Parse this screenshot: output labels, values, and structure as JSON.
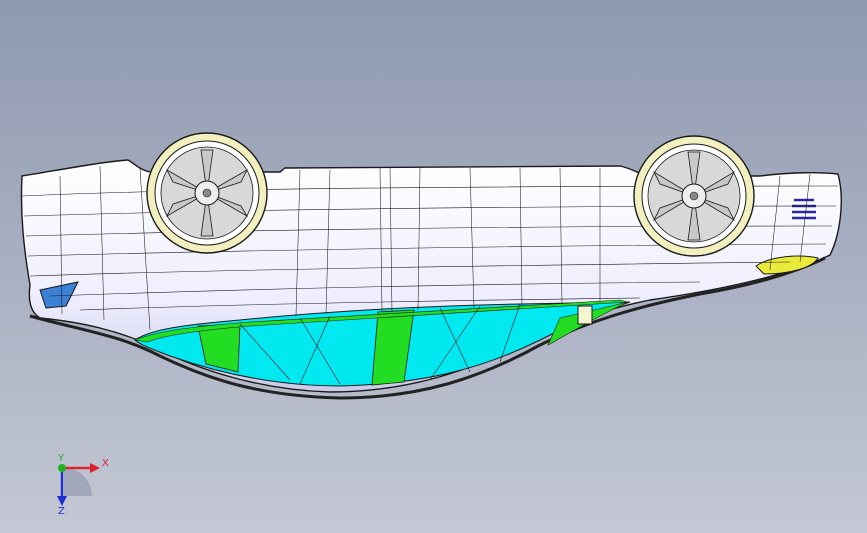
{
  "viewport": {
    "background_top": "#8f9aaf",
    "background_bottom": "#c4c8d4"
  },
  "model": {
    "body_color": "#f0f0ff",
    "body_shade": "#c9cbe8",
    "wire_color": "#1a1a1a",
    "underbody_cyan": "#00e8f0",
    "underbody_green": "#22dd22",
    "rim_color": "#f3f0c0",
    "spoke_color": "#c8c8c8",
    "headlight_color": "#3b82d6",
    "taillight_color": "#eaea3c",
    "vent_color": "#2a2aa0"
  },
  "triad": {
    "x_label": "X",
    "y_label": "Y",
    "z_label": "Z",
    "x_color": "#e0202a",
    "y_color": "#20b020",
    "z_color": "#2030d0"
  }
}
